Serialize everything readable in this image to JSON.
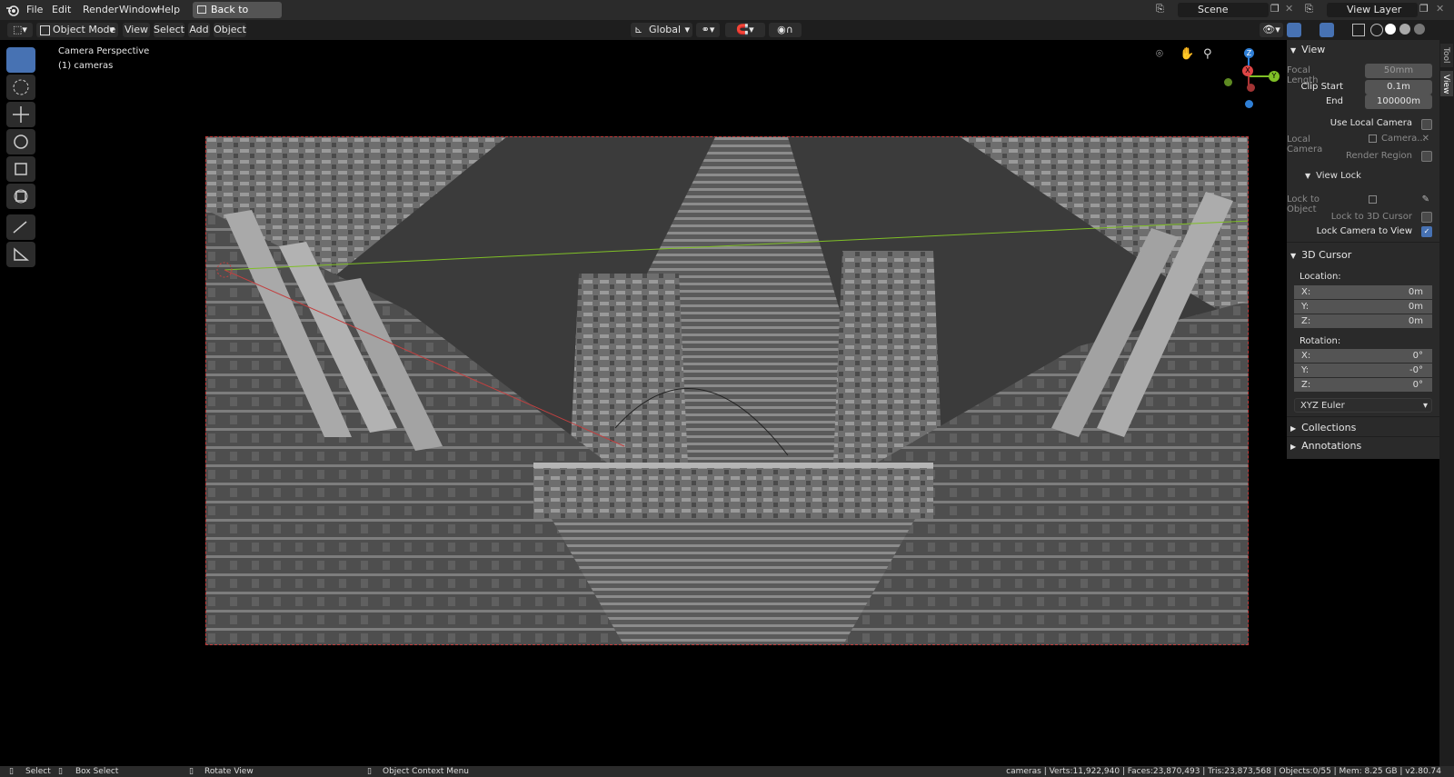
{
  "menubar": {
    "items": [
      "File",
      "Edit",
      "Render",
      "Window",
      "Help"
    ],
    "back_label": "Back to Previous",
    "scene": "Scene",
    "view_layer": "View Layer"
  },
  "header": {
    "mode": "Object Mode",
    "menus": [
      "View",
      "Select",
      "Add",
      "Object"
    ],
    "orientation": "Global"
  },
  "viewport": {
    "perspective_label": "Camera Perspective",
    "object_label": "(1) cameras",
    "gizmo": {
      "x": "X",
      "y": "Y",
      "z": "Z"
    }
  },
  "panel": {
    "tabs": [
      "Tool",
      "View"
    ],
    "view_section": "View",
    "focal_length_label": "Focal Length",
    "focal_length": "50mm",
    "clip_start_label": "Clip Start",
    "clip_start": "0.1m",
    "end_label": "End",
    "end": "100000m",
    "use_local_camera": "Use Local Camera",
    "local_camera_label": "Local Camera",
    "local_camera_value": "Camera...",
    "render_region": "Render Region",
    "view_lock_section": "View Lock",
    "lock_to_object": "Lock to Object",
    "lock_to_cursor": "Lock to 3D Cursor",
    "lock_camera": "Lock Camera to View",
    "cursor_section": "3D Cursor",
    "location_label": "Location:",
    "loc_x_label": "X:",
    "loc_x": "0m",
    "loc_y_label": "Y:",
    "loc_y": "0m",
    "loc_z_label": "Z:",
    "loc_z": "0m",
    "rotation_label": "Rotation:",
    "rot_x_label": "X:",
    "rot_x": "0°",
    "rot_y_label": "Y:",
    "rot_y": "-0°",
    "rot_z_label": "Z:",
    "rot_z": "0°",
    "rotation_mode": "XYZ Euler",
    "collections": "Collections",
    "annotations": "Annotations"
  },
  "status": {
    "select": "Select",
    "box_select": "Box Select",
    "rotate_view": "Rotate View",
    "context_menu": "Object Context Menu",
    "stats": "cameras | Verts:11,922,940 | Faces:23,870,493 | Tris:23,873,568 | Objects:0/55 | Mem: 8.25 GB | v2.80.74"
  },
  "colors": {
    "accent": "#4772b3",
    "frame": "#c23a3a",
    "x_axis": "#e04545",
    "y_axis": "#7fbf26",
    "z_axis": "#2f7fd6"
  }
}
